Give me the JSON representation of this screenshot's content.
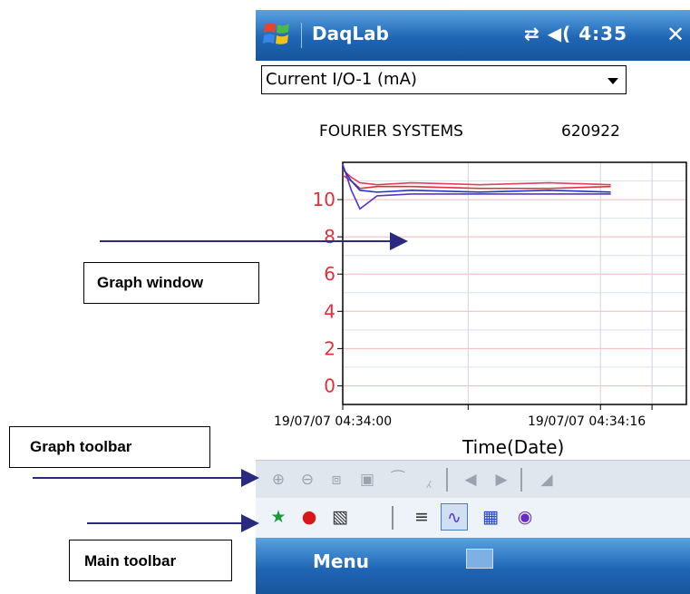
{
  "window": {
    "app_title": "DaqLab",
    "status": {
      "connectivity_icon": "sync-arrows-icon",
      "volume_icon": "speaker-icon",
      "time": "4:35"
    },
    "close_label": "✕"
  },
  "sensor_select": {
    "value": "Current I/O-1 (mA)"
  },
  "logger": {
    "company": "FOURIER SYSTEMS",
    "serial": "620922"
  },
  "chart_data": {
    "type": "line",
    "y_tick_labels": [
      "10",
      "8",
      "6",
      "4",
      "2",
      "0"
    ],
    "y_ticks": [
      10,
      8,
      6,
      4,
      2,
      0
    ],
    "ylim": [
      -1,
      12
    ],
    "x_tick_labels": [
      "19/07/07 04:34:00",
      "19/07/07 04:34:16"
    ],
    "x": [
      0,
      0.5,
      1,
      2,
      4,
      8,
      12,
      15.6
    ],
    "xlim": [
      0,
      20
    ],
    "xlabel": "Time(Date)",
    "grid": true,
    "series": [
      {
        "color": "#e0303a",
        "values": [
          11.3,
          11.0,
          10.6,
          10.7,
          10.7,
          10.6,
          10.6,
          10.7
        ]
      },
      {
        "color": "#e04060",
        "values": [
          11.6,
          11.2,
          10.9,
          10.8,
          10.9,
          10.8,
          10.9,
          10.8
        ]
      },
      {
        "color": "#5a33c8",
        "values": [
          11.9,
          10.5,
          9.5,
          10.2,
          10.3,
          10.3,
          10.3,
          10.3
        ]
      },
      {
        "color": "#2233cc",
        "values": [
          11.7,
          11.0,
          10.5,
          10.4,
          10.5,
          10.4,
          10.5,
          10.4
        ]
      }
    ]
  },
  "graph_toolbar": {
    "items": [
      {
        "name": "zoom-in-icon",
        "glyph": "⊕"
      },
      {
        "name": "zoom-out-icon",
        "glyph": "⊖"
      },
      {
        "name": "zoom-box-icon",
        "glyph": "⧈"
      },
      {
        "name": "fit-view-icon",
        "glyph": "▣"
      },
      {
        "name": "cursor-1-icon",
        "glyph": "⁀"
      },
      {
        "name": "cursor-2-icon",
        "glyph": "⁁"
      },
      {
        "name": "scroll-left-icon",
        "glyph": "◀"
      },
      {
        "name": "scroll-right-icon",
        "glyph": "▶"
      },
      {
        "name": "marker-icon",
        "glyph": "◢"
      }
    ]
  },
  "main_toolbar": {
    "items": [
      {
        "name": "run-icon",
        "glyph": "★",
        "color": "#1a9a3a"
      },
      {
        "name": "stop-icon",
        "glyph": "●",
        "color": "#d81818"
      },
      {
        "name": "logger-setup-icon",
        "glyph": "▧",
        "color": "#333333"
      },
      {
        "name": "sensors-icon",
        "glyph": "≡",
        "color": "#333333"
      },
      {
        "name": "graph-view-icon",
        "glyph": "∿",
        "color": "#5a33c8"
      },
      {
        "name": "table-view-icon",
        "glyph": "▦",
        "color": "#1a3ec8"
      },
      {
        "name": "meter-view-icon",
        "glyph": "◉",
        "color": "#6a2ac8"
      }
    ]
  },
  "menubar": {
    "menu_label": "Menu",
    "keyboard_icon": "keyboard-icon"
  },
  "callouts": {
    "graph_window": "Graph window",
    "graph_toolbar": "Graph toolbar",
    "main_toolbar": "Main toolbar"
  },
  "accent_colors": {
    "titlebar_blue": "#1f66b5",
    "arrow_navy": "#2a2a80"
  }
}
